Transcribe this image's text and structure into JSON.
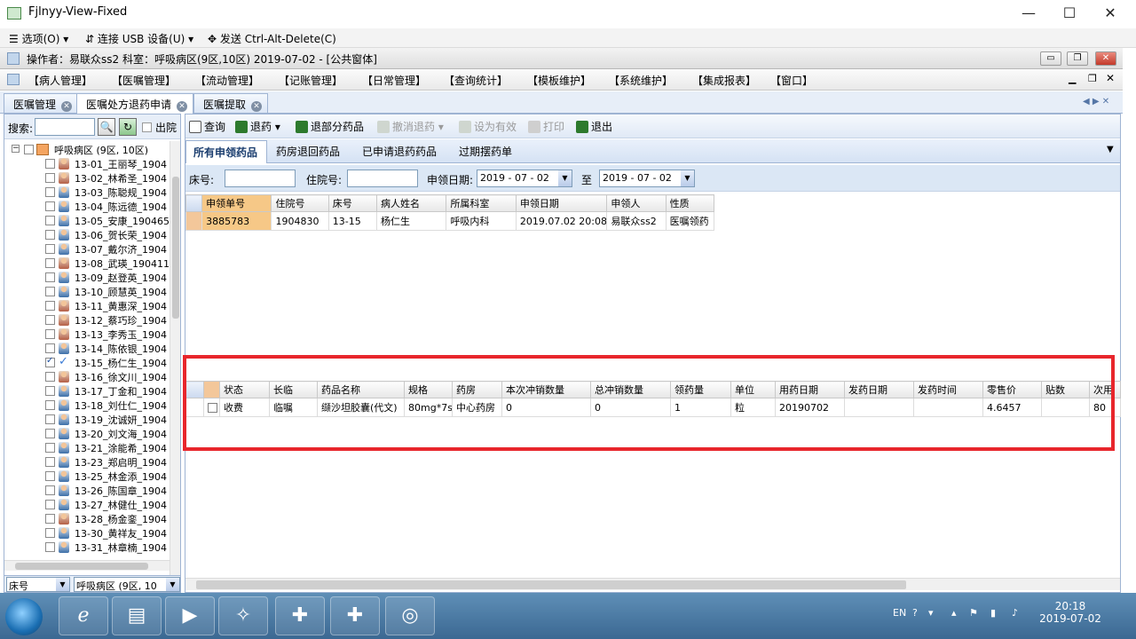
{
  "window": {
    "title": "Fjlnyy-View-Fixed",
    "toolbar": [
      "选项(O)",
      "连接 USB 设备(U)",
      "发送 Ctrl-Alt-Delete(C)"
    ]
  },
  "app": {
    "status": "操作者：易联众ss2  科室：呼吸病区(9区,10区)  2019-07-02 - [公共窗体]",
    "menu": [
      "【病人管理】",
      "【医嘱管理】",
      "【流动管理】",
      "【记账管理】",
      "【日常管理】",
      "【查询统计】",
      "【模板维护】",
      "【系统维护】",
      "【集成报表】",
      "【窗口】"
    ],
    "tabs": [
      "医嘱管理",
      "医嘱处方退药申请",
      "医嘱提取"
    ]
  },
  "left": {
    "search_label": "搜索:",
    "search_value": "",
    "discharge_label": "出院",
    "root": "呼吸病区 (9区, 10区)",
    "patients": [
      {
        "label": "13-01_王丽琴_1904",
        "g": "f"
      },
      {
        "label": "13-02_林希圣_1904",
        "g": "f"
      },
      {
        "label": "13-03_陈聪规_1904",
        "g": "m"
      },
      {
        "label": "13-04_陈远德_1904",
        "g": "m"
      },
      {
        "label": "13-05_安康_190465",
        "g": "m"
      },
      {
        "label": "13-06_贺长荣_1904",
        "g": "m"
      },
      {
        "label": "13-07_戴尔济_1904",
        "g": "m"
      },
      {
        "label": "13-08_武瑛_1904110",
        "g": "f"
      },
      {
        "label": "13-09_赵登英_1904",
        "g": "m"
      },
      {
        "label": "13-10_顾慧英_1904",
        "g": "m"
      },
      {
        "label": "13-11_黄惠深_1904",
        "g": "f"
      },
      {
        "label": "13-12_蔡巧珍_1904",
        "g": "f"
      },
      {
        "label": "13-13_李秀玉_1904",
        "g": "f"
      },
      {
        "label": "13-14_陈依银_1904",
        "g": "m"
      },
      {
        "label": "13-15_杨仁生_1904",
        "g": "chk",
        "checked": true
      },
      {
        "label": "13-16_徐文川_1904",
        "g": "f"
      },
      {
        "label": "13-17_丁金和_1904",
        "g": "m"
      },
      {
        "label": "13-18_刘仕仁_1904",
        "g": "m"
      },
      {
        "label": "13-19_沈诚妍_1904",
        "g": "m"
      },
      {
        "label": "13-20_刘文海_1904",
        "g": "m"
      },
      {
        "label": "13-21_涂能希_1904",
        "g": "m"
      },
      {
        "label": "13-23_郑启明_1904",
        "g": "m"
      },
      {
        "label": "13-25_林金添_1904",
        "g": "m"
      },
      {
        "label": "13-26_陈国章_1904",
        "g": "m"
      },
      {
        "label": "13-27_林健仕_1904",
        "g": "m"
      },
      {
        "label": "13-28_杨金銮_1904",
        "g": "f"
      },
      {
        "label": "13-30_黄祥友_1904",
        "g": "m"
      },
      {
        "label": "13-31_林章楠_1904",
        "g": "m"
      }
    ],
    "footer_sel1": "床号",
    "footer_sel2": "呼吸病区 (9区, 10"
  },
  "toolbar": [
    "查询",
    "退药",
    "退部分药品",
    "撤消退药",
    "设为有效",
    "打印",
    "退出"
  ],
  "subtabs": [
    "所有申领药品",
    "药房退回药品",
    "已申请退药药品",
    "过期摆药单"
  ],
  "filter": {
    "bed_label": "床号:",
    "bed_value": "",
    "inpatient_label": "住院号:",
    "inpatient_value": "",
    "date_label": "申领日期:",
    "date_from": "2019 - 07 - 02",
    "to_label": "至",
    "date_to": "2019 - 07 - 02"
  },
  "upper_grid": {
    "columns": [
      "申领单号",
      "住院号",
      "床号",
      "病人姓名",
      "所属科室",
      "申领日期",
      "申领人",
      "性质"
    ],
    "rows": [
      [
        "3885783",
        "1904830",
        "13-15",
        "杨仁生",
        "呼吸内科",
        "2019.07.02 20:08",
        "易联众ss2",
        "医嘱领药"
      ]
    ]
  },
  "lower_grid": {
    "columns": [
      "状态",
      "长临",
      "药品名称",
      "规格",
      "药房",
      "本次冲销数量",
      "总冲销数量",
      "领药量",
      "单位",
      "用药日期",
      "发药日期",
      "发药时间",
      "零售价",
      "贴数",
      "次用"
    ],
    "rows": [
      [
        "收费",
        "临嘱",
        "缬沙坦胶囊(代文)",
        "80mg*7s",
        "中心药房",
        "0",
        "0",
        "1",
        "粒",
        "20190702",
        "",
        "",
        "4.6457",
        "",
        "80"
      ]
    ]
  },
  "taskbar": {
    "lang": "EN",
    "time": "20:18",
    "date": "2019-07-02"
  }
}
